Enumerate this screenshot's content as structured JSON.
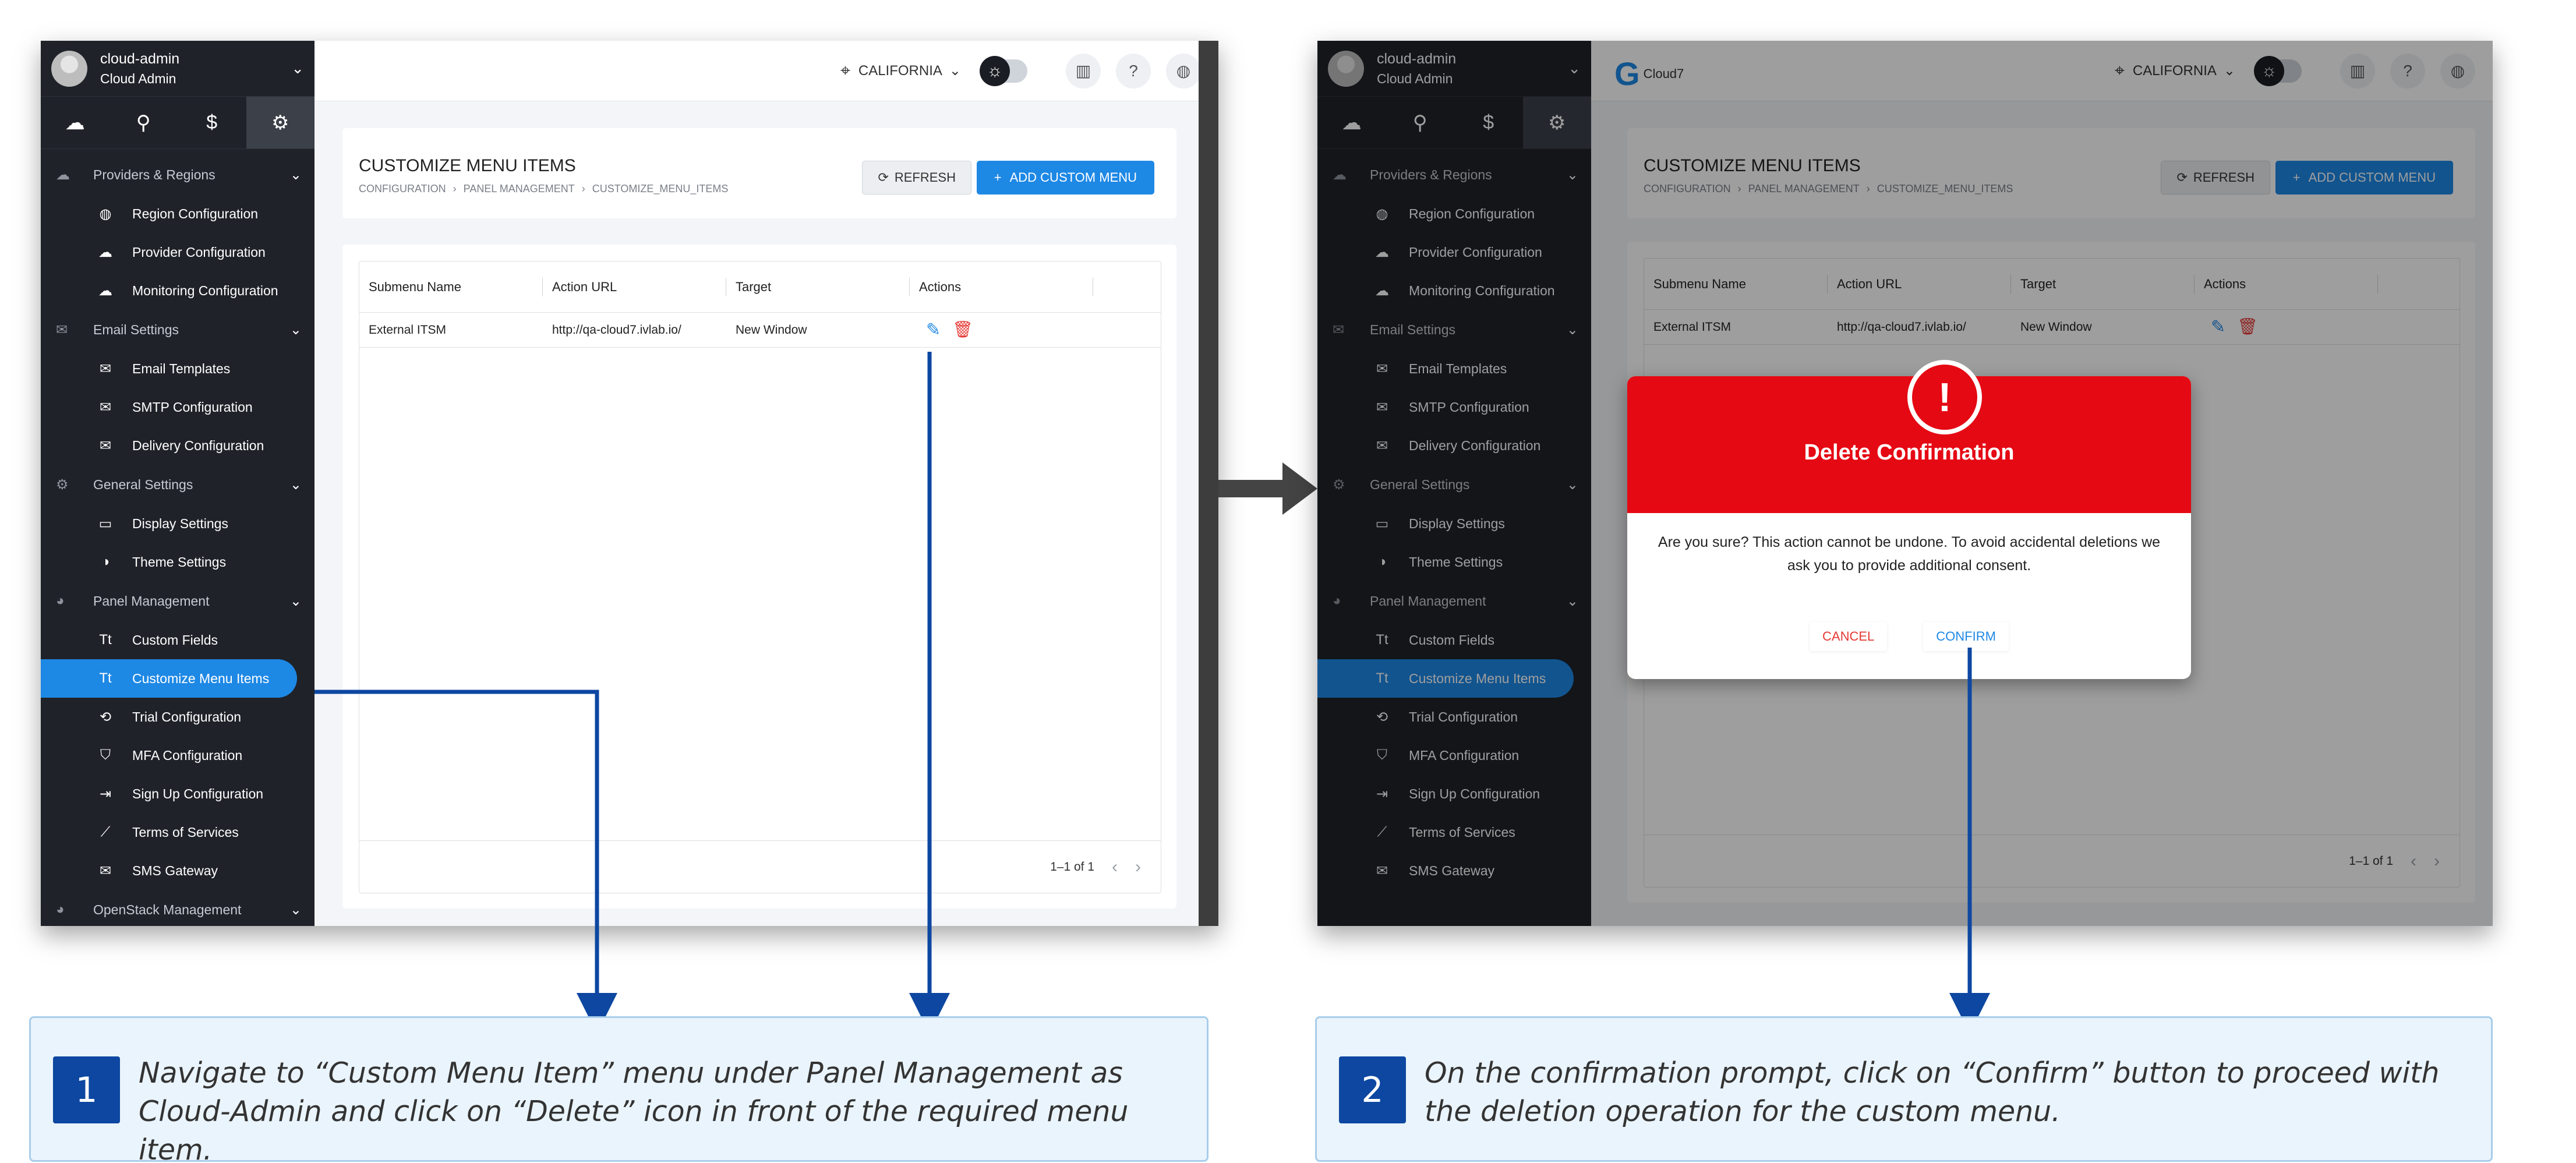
{
  "user": {
    "name": "cloud-admin",
    "role": "Cloud Admin"
  },
  "sidebar": {
    "tabs": [
      "cloud-icon",
      "user-icon",
      "dollar-icon",
      "gear-icon"
    ],
    "groups": [
      {
        "label": "Providers & Regions",
        "items": [
          "Region Configuration",
          "Provider Configuration",
          "Monitoring Configuration"
        ]
      },
      {
        "label": "Email Settings",
        "items": [
          "Email Templates",
          "SMTP Configuration",
          "Delivery Configuration"
        ]
      },
      {
        "label": "General Settings",
        "items": [
          "Display Settings",
          "Theme Settings"
        ]
      },
      {
        "label": "Panel Management",
        "items": [
          "Custom Fields",
          "Customize Menu Items",
          "Trial Configuration",
          "MFA Configuration",
          "Sign Up Configuration",
          "Terms of Services",
          "SMS Gateway"
        ]
      },
      {
        "label": "OpenStack Management",
        "items": []
      }
    ],
    "active_item": "Customize Menu Items"
  },
  "topbar": {
    "location": "CALIFORNIA",
    "logo_text": "Cloud7"
  },
  "page": {
    "title": "CUSTOMIZE MENU ITEMS",
    "breadcrumb": [
      "CONFIGURATION",
      "›",
      "PANEL MANAGEMENT",
      "›",
      "CUSTOMIZE_MENU_ITEMS"
    ],
    "refresh_label": "REFRESH",
    "add_label": "ADD CUSTOM MENU"
  },
  "table": {
    "columns": [
      "Submenu Name",
      "Action URL",
      "Target",
      "Actions"
    ],
    "rows": [
      {
        "name": "External ITSM",
        "url": "http://qa-cloud7.ivlab.io/",
        "target": "New Window"
      }
    ],
    "pagination": "1–1 of 1"
  },
  "dialog": {
    "title": "Delete Confirmation",
    "message": "Are you sure? This action cannot be undone. To avoid accidental deletions we ask you to provide additional consent.",
    "cancel_label": "CANCEL",
    "confirm_label": "CONFIRM"
  },
  "callouts": [
    {
      "step": "1",
      "text": "Navigate to “Custom Menu Item” menu under Panel Management as Cloud-Admin and click on “Delete” icon in front of the required menu item."
    },
    {
      "step": "2",
      "text": "On the confirmation prompt, click on “Confirm” button to proceed with the deletion operation for the custom menu."
    }
  ],
  "colors": {
    "accent": "#1e88e5",
    "danger": "#e50914",
    "sidebar": "#1f2229",
    "callout_bg": "#eaf4fc"
  }
}
